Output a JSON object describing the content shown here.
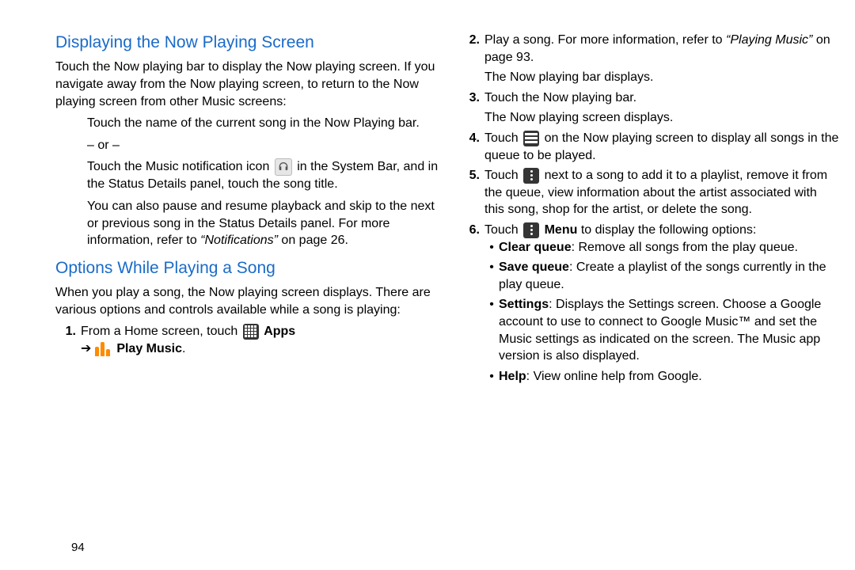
{
  "page_number": "94",
  "left": {
    "h1": "Displaying the Now Playing Screen",
    "p1": "Touch the Now playing bar to display the Now playing screen. If you navigate away from the Now playing screen, to return to the Now playing screen from other Music screens:",
    "sub1": "Touch the name of the current song in the Now Playing bar.",
    "or": "– or –",
    "sub2a": "Touch the Music notification icon ",
    "sub2b": " in the System Bar, and in the Status Details panel, touch the song title.",
    "sub3a": "You can also pause and resume playback and skip to the next or previous song in the Status Details panel. For more information, refer to ",
    "sub3i": "“Notifications”",
    "sub3b": "  on page 26.",
    "h2": "Options While Playing a Song",
    "p2": "When you play a song, the Now playing screen displays. There are various options and controls available while a song is playing:",
    "step1_num": "1.",
    "step1a": "From a Home screen, touch ",
    "apps": " Apps",
    "arrow": " ➔ ",
    "playmusic": " Play Music",
    "period": "."
  },
  "right": {
    "step2_num": "2.",
    "step2a": "Play a song. For more information, refer to ",
    "step2i": "“Playing Music”",
    "step2b": "  on page 93.",
    "step2c": "The Now playing bar displays.",
    "step3_num": "3.",
    "step3a": "Touch the Now playing bar.",
    "step3b": "The Now playing screen displays.",
    "step4_num": "4.",
    "step4a": "Touch ",
    "step4b": " on the Now playing screen to display all songs in the queue to be played.",
    "step5_num": "5.",
    "step5a": "Touch ",
    "step5b": " next to a song to add it to a playlist, remove it from the queue, view information about the artist associated with this song, shop for the artist, or delete the song.",
    "step6_num": "6.",
    "step6a": "Touch ",
    "step6menu": " Menu",
    "step6b": " to display the following options:",
    "b1_label": "Clear queue",
    "b1_text": ": Remove all songs from the play queue.",
    "b2_label": "Save queue",
    "b2_text": ": Create a playlist of the songs currently in the play queue.",
    "b3_label": "Settings",
    "b3_text_a": ": Displays the Settings screen. Choose a Google account to use to connect to Google Music",
    "b3_tm": "™",
    "b3_text_b": " and set the Music settings as indicated on the screen. The Music app version is also displayed.",
    "b4_label": "Help",
    "b4_text": ": View online help from Google."
  }
}
